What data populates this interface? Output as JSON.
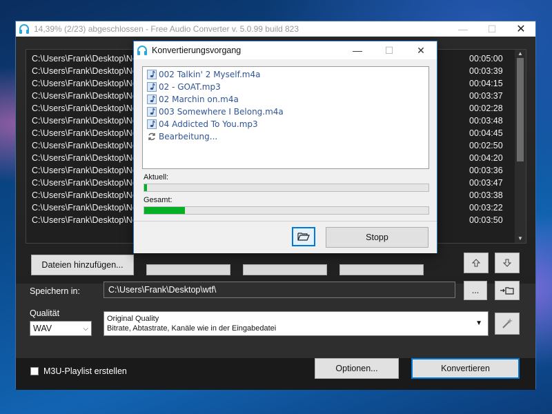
{
  "main_window": {
    "title": "14,39% (2/23) abgeschlossen - Free Audio Converter  v. 5.0.99 build 823",
    "controls": {
      "minimize": "—",
      "maximize": "☐",
      "close": "✕"
    }
  },
  "file_list": {
    "rows": [
      {
        "path": "C:\\Users\\Frank\\Desktop\\Ne",
        "duration": "00:05:00"
      },
      {
        "path": "C:\\Users\\Frank\\Desktop\\Ne",
        "duration": "00:03:39"
      },
      {
        "path": "C:\\Users\\Frank\\Desktop\\Ne",
        "duration": "00:04:15"
      },
      {
        "path": "C:\\Users\\Frank\\Desktop\\Ne",
        "duration": "00:03:37"
      },
      {
        "path": "C:\\Users\\Frank\\Desktop\\Ne",
        "duration": "00:02:28"
      },
      {
        "path": "C:\\Users\\Frank\\Desktop\\Ne",
        "duration": "00:03:48"
      },
      {
        "path": "C:\\Users\\Frank\\Desktop\\Ne",
        "duration": "00:04:45"
      },
      {
        "path": "C:\\Users\\Frank\\Desktop\\Ne",
        "duration": "00:02:50"
      },
      {
        "path": "C:\\Users\\Frank\\Desktop\\Ne",
        "duration": "00:04:20"
      },
      {
        "path": "C:\\Users\\Frank\\Desktop\\Ne",
        "duration": "00:03:36"
      },
      {
        "path": "C:\\Users\\Frank\\Desktop\\Ne",
        "duration": "00:03:47"
      },
      {
        "path": "C:\\Users\\Frank\\Desktop\\Ne",
        "duration": "00:03:38"
      },
      {
        "path": "C:\\Users\\Frank\\Desktop\\Ne",
        "duration": "00:03:22"
      },
      {
        "path": "C:\\Users\\Frank\\Desktop\\Ne",
        "duration": "00:03:50"
      }
    ]
  },
  "toolbar": {
    "add_files_label": "Dateien hinzufügen...",
    "move_up_icon": "arrow-up-icon",
    "move_down_icon": "arrow-down-icon"
  },
  "output": {
    "save_label": "Speichern in:",
    "save_path": "C:\\Users\\Frank\\Desktop\\wtf\\",
    "browse_label": "...",
    "quality_label": "Qualität",
    "format_value": "WAV",
    "quality_title": "Original Quality",
    "quality_desc": "Bitrate, Abtastrate, Kanäle wie in der Eingabedatei"
  },
  "bottom": {
    "playlist_label": "M3U-Playlist erstellen",
    "playlist_checked": false,
    "options_label": "Optionen...",
    "convert_label": "Konvertieren"
  },
  "dialog": {
    "title": "Konvertierungsvorgang",
    "controls": {
      "minimize": "—",
      "maximize": "☐",
      "close": "✕"
    },
    "tasks": [
      {
        "name": "002 Talkin' 2 Myself.m4a",
        "icon": "music-note-icon"
      },
      {
        "name": "02 - GOAT.mp3",
        "icon": "music-note-icon"
      },
      {
        "name": "02 Marchin on.m4a",
        "icon": "music-note-icon"
      },
      {
        "name": "003 Somewhere I Belong.m4a",
        "icon": "music-note-icon"
      },
      {
        "name": "04 Addicted To You.mp3",
        "icon": "music-note-icon"
      },
      {
        "name": "Bearbeitung...",
        "icon": "refresh-icon"
      }
    ],
    "current_label": "Aktuell:",
    "current_progress": 0.01,
    "total_label": "Gesamt:",
    "total_progress": 0.1439,
    "stop_label": "Stopp",
    "progress_color": "#06b025"
  }
}
